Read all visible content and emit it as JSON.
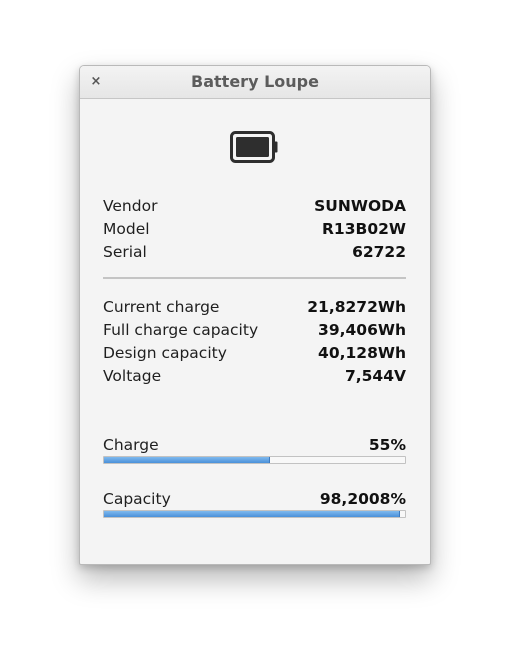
{
  "window": {
    "title": "Battery Loupe",
    "close_label": "×"
  },
  "icons": {
    "battery": "battery-icon"
  },
  "info": {
    "vendor_label": "Vendor",
    "vendor_value": "SUNWODA",
    "model_label": "Model",
    "model_value": "R13B02W",
    "serial_label": "Serial",
    "serial_value": "62722"
  },
  "energy": {
    "current_charge_label": "Current charge",
    "current_charge_value": "21,8272Wh",
    "full_capacity_label": "Full charge capacity",
    "full_capacity_value": "39,406Wh",
    "design_capacity_label": "Design capacity",
    "design_capacity_value": "40,128Wh",
    "voltage_label": "Voltage",
    "voltage_value": "7,544V"
  },
  "bars": {
    "charge_label": "Charge",
    "charge_value": "55%",
    "charge_fraction": 0.55,
    "capacity_label": "Capacity",
    "capacity_value": "98,2008%",
    "capacity_fraction": 0.982008
  },
  "colors": {
    "progress_fill": "#4a90d9",
    "window_bg": "#f4f4f4"
  }
}
